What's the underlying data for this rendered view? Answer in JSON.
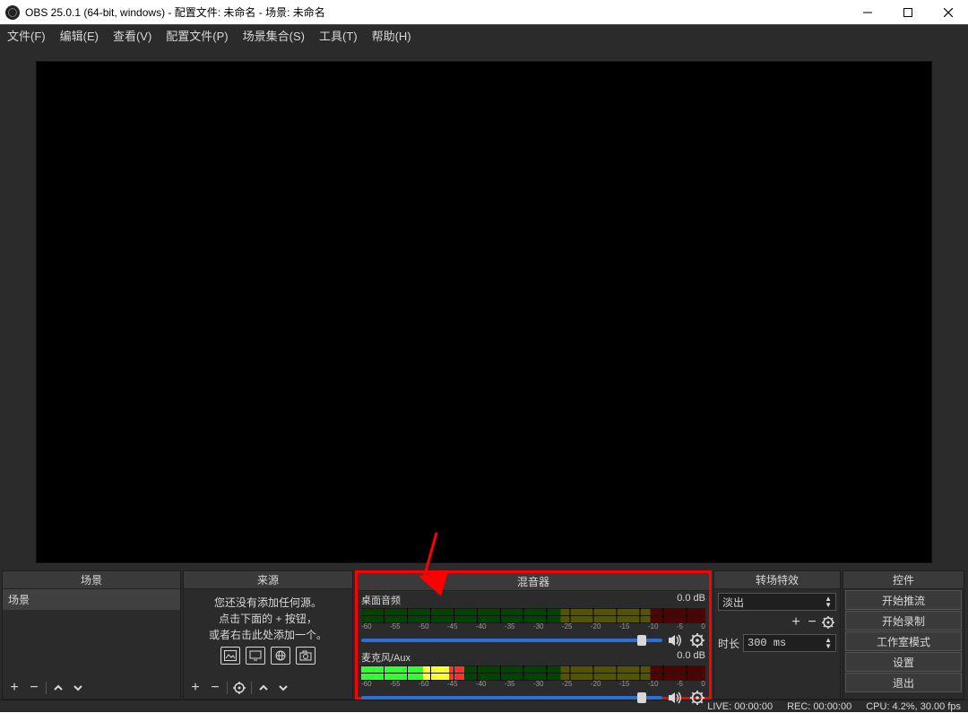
{
  "titlebar": {
    "title": "OBS 25.0.1 (64-bit, windows) - 配置文件: 未命名 - 场景: 未命名"
  },
  "menu": {
    "file": "文件(F)",
    "edit": "编辑(E)",
    "view": "查看(V)",
    "profile": "配置文件(P)",
    "scene_coll": "场景集合(S)",
    "tools": "工具(T)",
    "help": "帮助(H)"
  },
  "docks": {
    "scenes": {
      "title": "场景",
      "items": [
        "场景"
      ]
    },
    "sources": {
      "title": "来源",
      "empty_l1": "您还没有添加任何源。",
      "empty_l2": "点击下面的 + 按钮，",
      "empty_l3": "或者右击此处添加一个。"
    },
    "mixer": {
      "title": "混音器",
      "channels": [
        {
          "name": "桌面音频",
          "db": "0.0 dB",
          "live": 0
        },
        {
          "name": "麦克风/Aux",
          "db": "0.0 dB",
          "live": 30
        }
      ],
      "ticks": [
        "-60",
        "-55",
        "-50",
        "-45",
        "-40",
        "-35",
        "-30",
        "-25",
        "-20",
        "-15",
        "-10",
        "-5",
        "0"
      ]
    },
    "transitions": {
      "title": "转场特效",
      "combo": "淡出",
      "duration_label": "时长",
      "duration_value": "300 ms"
    },
    "controls": {
      "title": "控件",
      "buttons": [
        "开始推流",
        "开始录制",
        "工作室模式",
        "设置",
        "退出"
      ]
    }
  },
  "status": {
    "live": "LIVE: 00:00:00",
    "rec": "REC: 00:00:00",
    "cpu": "CPU: 4.2%, 30.00 fps"
  }
}
